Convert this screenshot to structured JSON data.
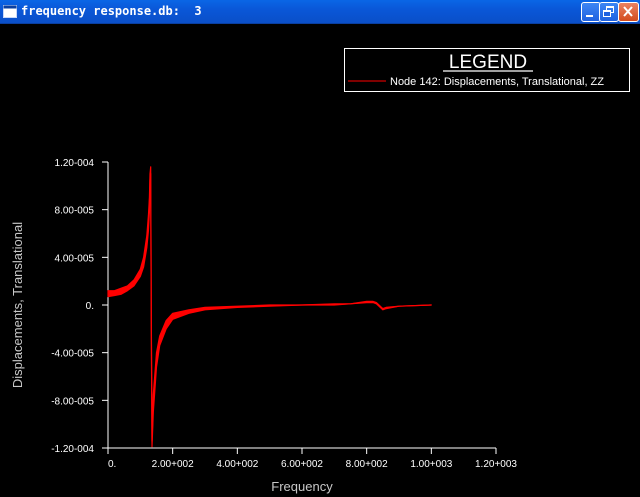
{
  "window": {
    "title": "frequency response.db:  3",
    "buttons": {
      "minimize": "minimize-icon",
      "restore": "restore-icon",
      "close": "close-icon"
    },
    "title_color": "#ffffff",
    "titlebar_color": "#0a5ad8"
  },
  "chart_data": {
    "type": "line",
    "background": "#000000",
    "axis_color": "#ffffff",
    "legend": {
      "title": "LEGEND",
      "placement": "top-right",
      "entries": [
        {
          "label": "Node 142: Displacements, Translational, ZZ",
          "color": "#ff0000"
        }
      ]
    },
    "xlabel": "Frequency",
    "ylabel": "Displacements, Translational",
    "xlim": [
      0,
      1200
    ],
    "ylim": [
      -0.00012,
      0.00012
    ],
    "xticks": [
      0,
      200,
      400,
      600,
      800,
      1000,
      1200
    ],
    "xtick_labels": [
      "0.",
      "2.00+002",
      "4.00+002",
      "6.00+002",
      "8.00+002",
      "1.00+003",
      "1.20+003"
    ],
    "yticks": [
      0.00012,
      8e-05,
      4e-05,
      0,
      -4e-05,
      -8e-05,
      -0.00012
    ],
    "ytick_labels": [
      "1.20-004",
      "8.00-005",
      "4.00-005",
      "0.",
      "-4.00-005",
      "-8.00-005",
      "-1.20-004"
    ],
    "grid": false,
    "series": [
      {
        "name": "Node 142: Displacements, Translational, ZZ",
        "color": "#ff0000",
        "band": true,
        "x": [
          0,
          20,
          40,
          60,
          80,
          100,
          110,
          120,
          125,
          128,
          130,
          132,
          134,
          136,
          140,
          150,
          160,
          180,
          200,
          250,
          300,
          400,
          500,
          600,
          700,
          750,
          800,
          820,
          830,
          850,
          860,
          900,
          1000
        ],
        "upper": [
          1.2e-05,
          1.2e-05,
          1.4e-05,
          1.6e-05,
          2.1e-05,
          3e-05,
          4e-05,
          5.8e-05,
          7.5e-05,
          9e-05,
          0.00011,
          0.000116,
          -1e-05,
          -0.00011,
          -7.5e-05,
          -4e-05,
          -2.6e-05,
          -1.3e-05,
          -7e-06,
          -4e-06,
          -2e-06,
          -1e-06,
          0,
          0,
          1e-06,
          1e-06,
          3e-06,
          3e-06,
          2e-06,
          -3e-06,
          -2e-06,
          -1e-06,
          0
        ],
        "lower": [
          7e-06,
          8e-06,
          9e-06,
          1.2e-05,
          1.6e-05,
          2.4e-05,
          3.2e-05,
          4.8e-05,
          6.2e-05,
          7.8e-05,
          0.0001,
          0.000105,
          -2e-05,
          -0.000119,
          -9e-05,
          -5.2e-05,
          -3.4e-05,
          -2e-05,
          -1.2e-05,
          -7e-06,
          -4e-06,
          -2e-06,
          -1e-06,
          0,
          0,
          1e-06,
          2e-06,
          2e-06,
          1e-06,
          -4e-06,
          -3e-06,
          -1e-06,
          0
        ]
      }
    ]
  }
}
